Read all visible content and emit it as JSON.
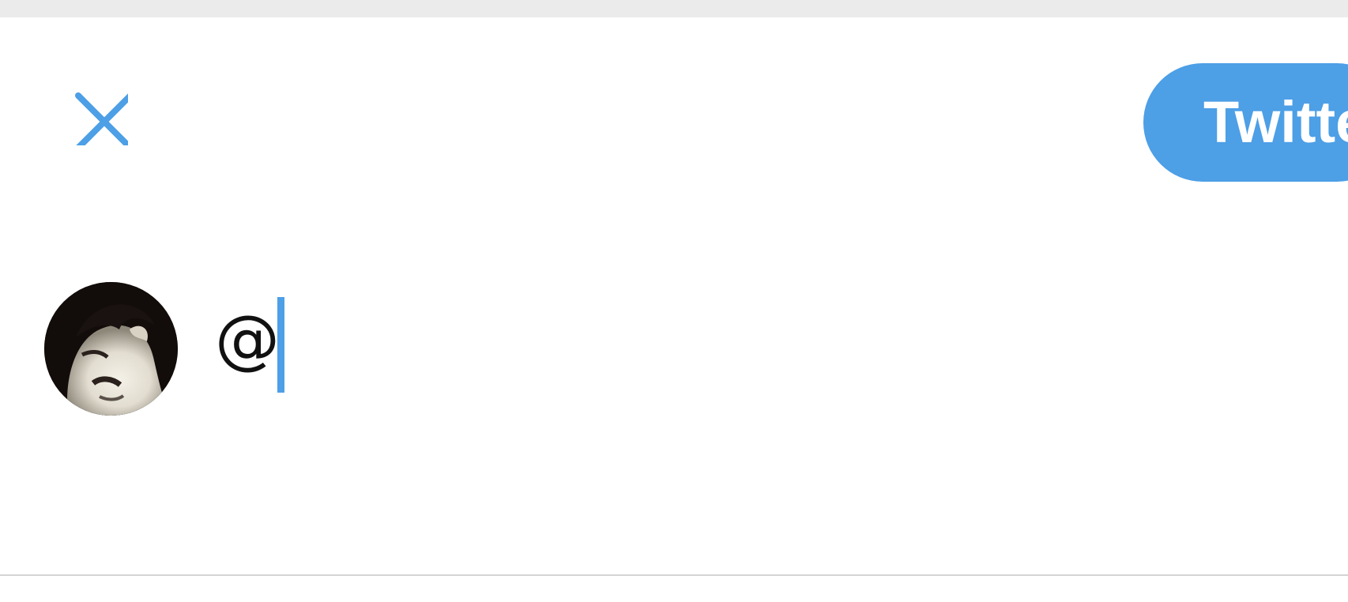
{
  "header": {
    "close_icon": "close-icon",
    "tweet_label": "Twitter",
    "accent_color": "#4d9fe6"
  },
  "composer": {
    "avatar": "user-avatar-photo",
    "text_value": "@"
  }
}
